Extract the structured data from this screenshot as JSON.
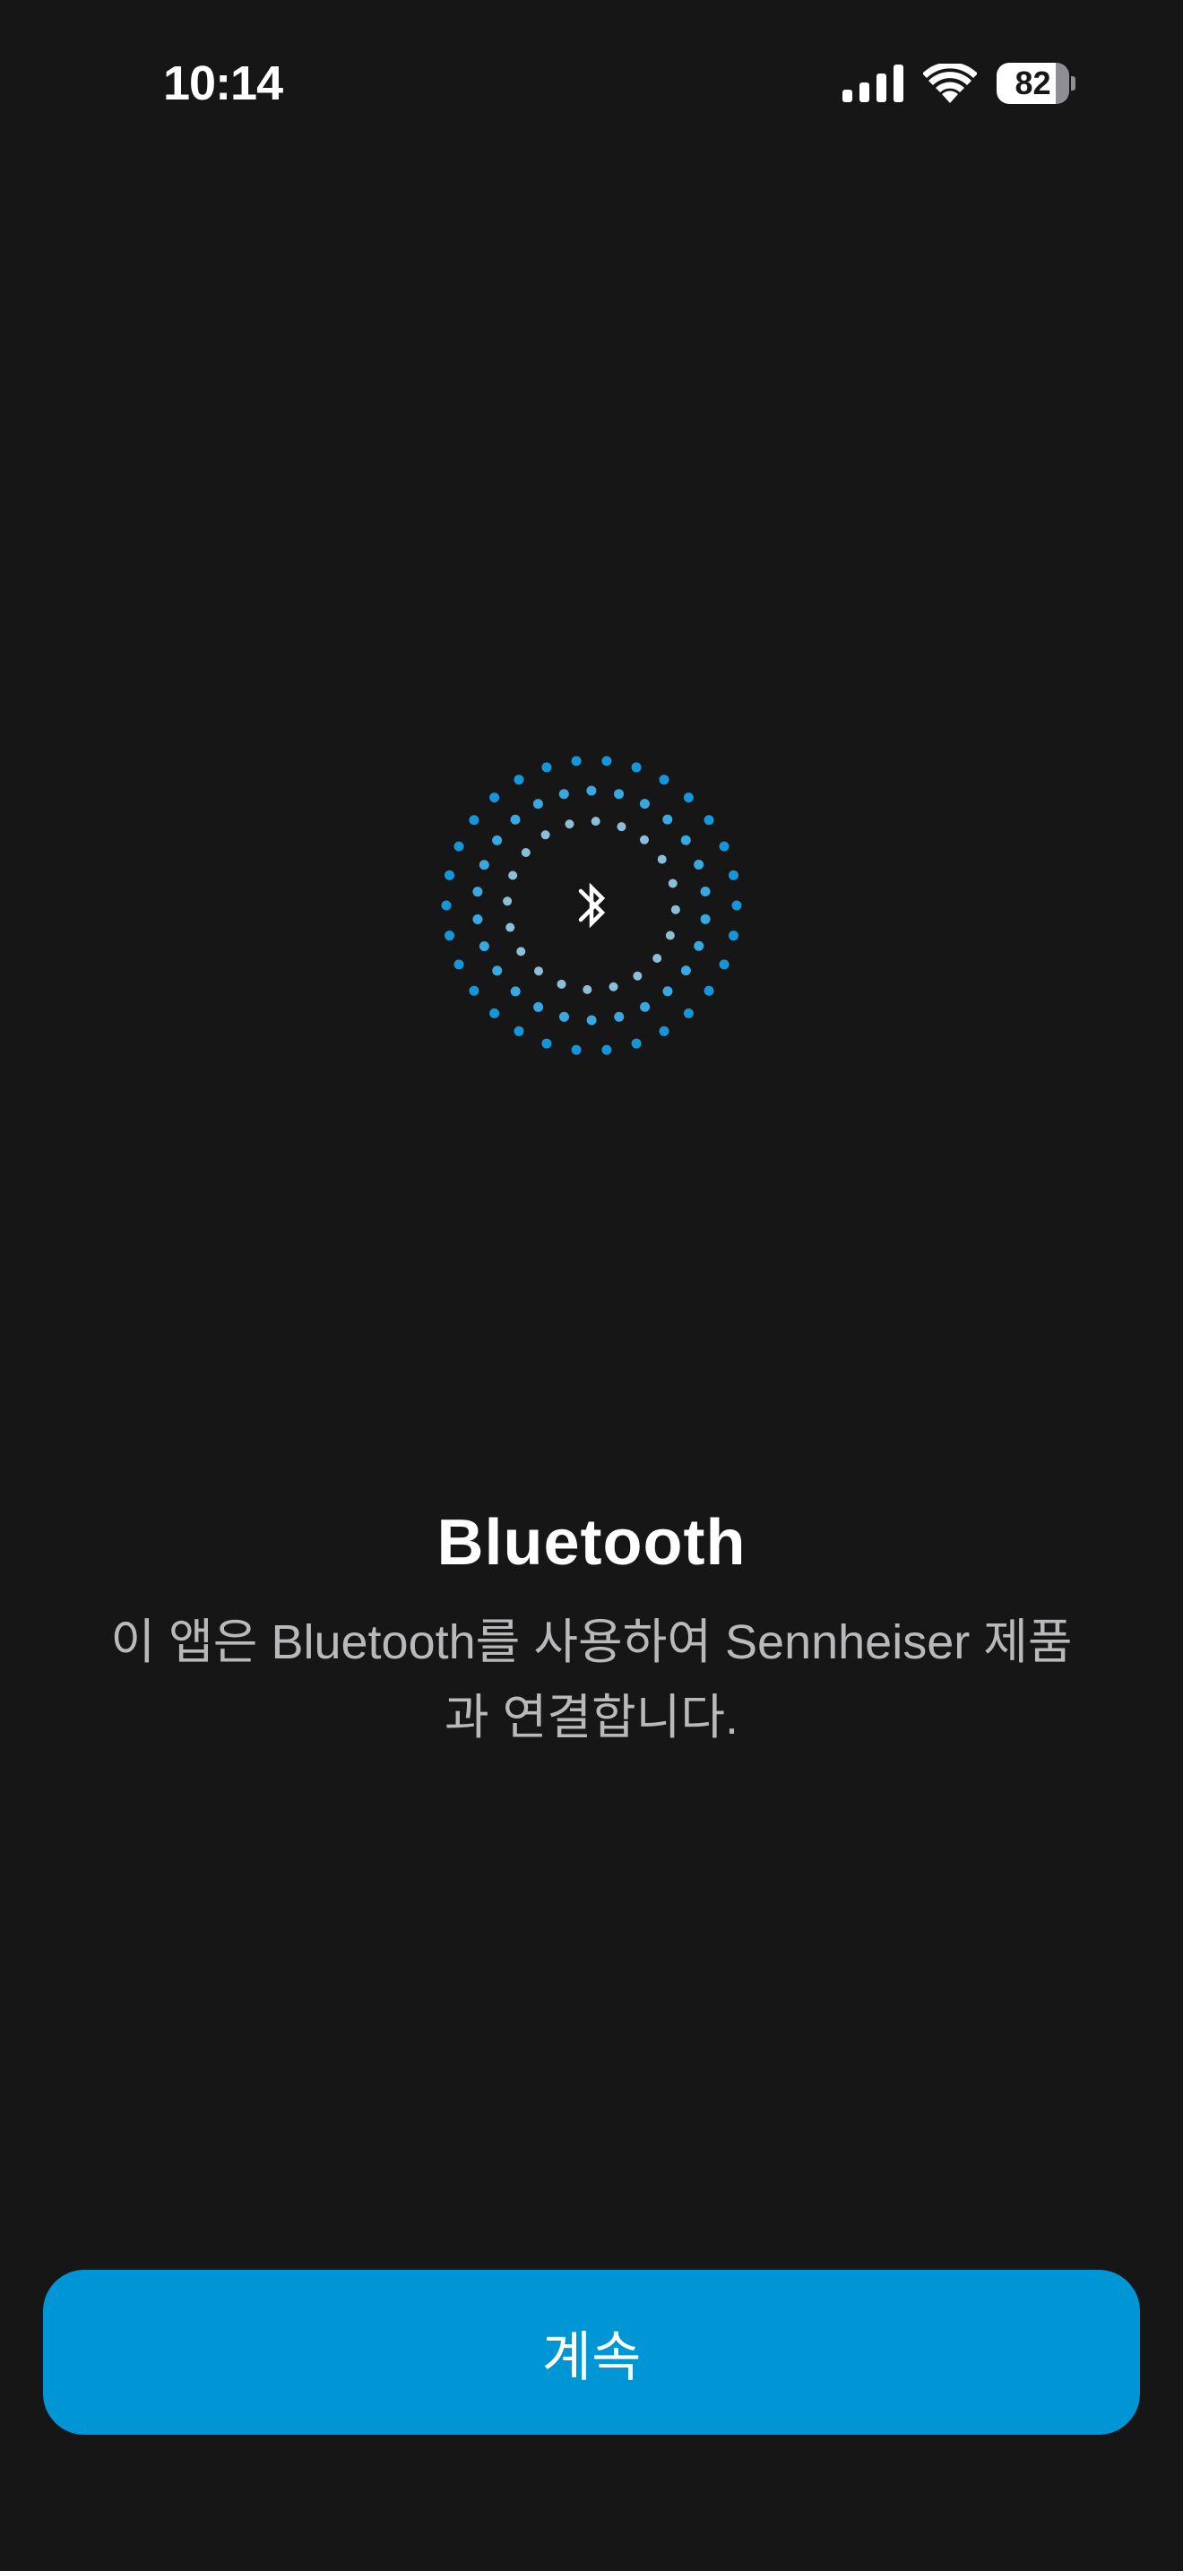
{
  "status_bar": {
    "time": "10:14",
    "battery_level": "82",
    "battery_fraction": 0.82,
    "icons": [
      "cellular-signal-icon",
      "wifi-icon",
      "battery-icon"
    ]
  },
  "graphic": {
    "icon": "bluetooth-icon",
    "colors": {
      "outer_dots": "#1596d8",
      "middle_dots": "#3aa8e0",
      "inner_dots": "#8bbfd9",
      "symbol": "#ffffff"
    }
  },
  "content": {
    "title": "Bluetooth",
    "description_line1": "이 앱은 Bluetooth를 사용하여 Sennheiser 제품",
    "description_line2": "과 연결합니다."
  },
  "actions": {
    "continue_label": "계속"
  },
  "theme": {
    "background": "#161617",
    "accent": "#0096d6",
    "text_secondary": "#b9b9bb"
  }
}
